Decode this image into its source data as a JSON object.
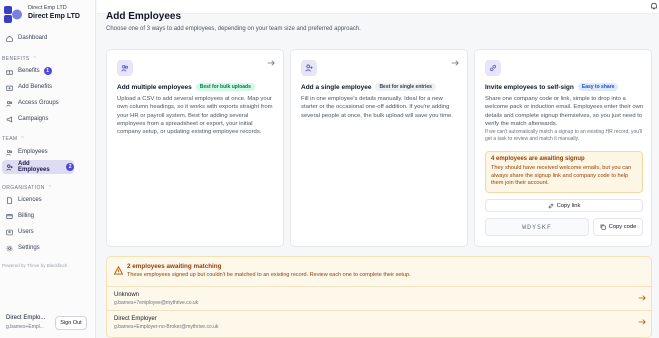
{
  "brand": {
    "subtitle": "Direct Emp LTD",
    "name": "Direct Emp LTD",
    "logo_icon": "brand-logo-icon",
    "accent": "#3b3fc4"
  },
  "sidebar": {
    "dashboard": "Dashboard",
    "benefits_section": "BENEFITS",
    "benefits": {
      "label": "Benefits",
      "badge": "1"
    },
    "add_benefits": "Add Benefits",
    "access_groups": "Access Groups",
    "campaigns": "Campaigns",
    "team_section": "TEAM",
    "employees": "Employees",
    "add_employees": {
      "label": "Add Employees",
      "badge": "2"
    },
    "organisation_section": "ORGANISATION",
    "licences": "Licences",
    "billing": "Billing",
    "users": "Users",
    "settings": "Settings",
    "powered_by": "Powered by Thrive by Blackfinch"
  },
  "user": {
    "name": "Direct Emplo...",
    "email": "g.barnes+Empl...",
    "signout": "Sign Out"
  },
  "page": {
    "title": "Add Employees",
    "subtitle": "Choose one of 3 ways to add employees, depending on your team size and preferred approach."
  },
  "cards": {
    "multiple": {
      "title": "Add multiple employees",
      "tag": "Best for bulk uploads",
      "description": "Upload a CSV to add several employees at once. Map your own column headings, so it works with exports straight from your HR or payroll system. Best for adding several employees from a spreadsheet or export, your initial company setup, or updating existing employee records."
    },
    "single": {
      "title": "Add a single employee",
      "tag": "Best for single entries",
      "description": "Fill in one employee's details manually. Ideal for a new starter or the occasional one-off addition. If you're adding several people at once, the bulk upload will save you time."
    },
    "self_sign": {
      "title": "Invite employees to self-sign",
      "tag": "Easy to share",
      "description": "Share one company code or link, simple to drop into a welcome pack or induction email. Employees enter their own details and complete signup themselves, so you just need to verify the match afterwards.",
      "note": "If we can't automatically match a signup to an existing HR record, you'll get a task to review and match it manually.",
      "awaiting_title": "4 employees are awaiting signup",
      "awaiting_text": "They should have received welcome emails, but you can always share the signup link and company code to help them join their account.",
      "copy_link": "Copy link",
      "code": "WDYSKF",
      "copy_code": "Copy code"
    }
  },
  "matching": {
    "title": "2 employees awaiting matching",
    "subtitle": "These employees signed up but couldn't be matched to an existing record. Review each one to complete their setup.",
    "rows": [
      {
        "name": "Unknown",
        "email": "g.barnes+7employee@mythrive.co.uk"
      },
      {
        "name": "Direct Employer",
        "email": "g.barnes+Employer-no-Broker@mythrive.co.uk"
      }
    ]
  }
}
